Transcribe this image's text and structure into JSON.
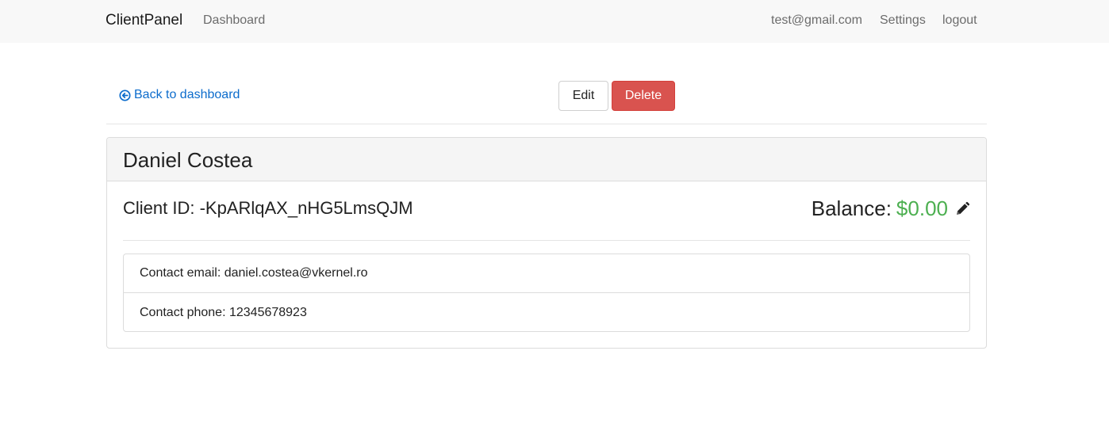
{
  "navbar": {
    "brand": "ClientPanel",
    "dashboard_link": "Dashboard",
    "user_email": "test@gmail.com",
    "settings_link": "Settings",
    "logout_link": "logout"
  },
  "actions": {
    "back_label": "Back to dashboard",
    "back_icon": "arrow-circle-left-icon",
    "edit_label": "Edit",
    "delete_label": "Delete"
  },
  "client": {
    "name": "Daniel Costea",
    "id_line": "Client ID: -KpARlqAX_nHG5LmsQJM",
    "balance_label": "Balance:",
    "balance_value": "$0.00",
    "balance_edit_icon": "pencil-icon",
    "contact_email_line": "Contact email: daniel.costea@vkernel.ro",
    "contact_phone_line": "Contact phone: 12345678923"
  },
  "colors": {
    "link": "#0c6ccc",
    "danger": "#d9534f",
    "balance_positive": "#4caf50",
    "navbar_bg": "#f8f8f8"
  }
}
